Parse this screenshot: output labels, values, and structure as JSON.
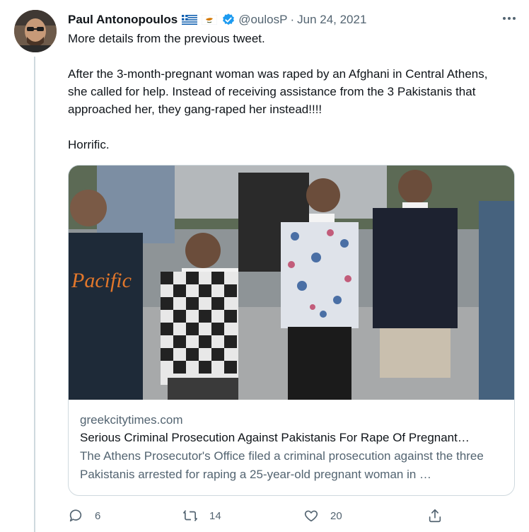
{
  "tweet": {
    "author_name": "Paul Antonopoulos",
    "handle": "@oulosP",
    "separator": "·",
    "date": "Jun 24, 2021",
    "verified": true,
    "flags": [
      "greece-flag-icon",
      "cyprus-flag-icon"
    ],
    "text_lines": [
      "More details from the previous tweet.",
      "After the 3-month-pregnant woman was raped by an Afghani in Central Athens, she called for help. Instead of receiving assistance from the 3 Pakistanis that approached her, they gang-raped her instead!!!!",
      "Horrific."
    ]
  },
  "card": {
    "domain": "greekcitytimes.com",
    "title": "Serious Criminal Prosecution Against Pakistanis For Rape Of Pregnant…",
    "description": "The Athens Prosecutor's Office filed a criminal prosecution against the three Pakistanis arrested for raping a 25-year-old pregnant woman in …"
  },
  "actions": {
    "replies": "6",
    "retweets": "14",
    "likes": "20"
  },
  "colors": {
    "accent": "#1d9bf0",
    "text": "#0f1419",
    "secondary": "#536471",
    "border": "#cfd9de"
  }
}
